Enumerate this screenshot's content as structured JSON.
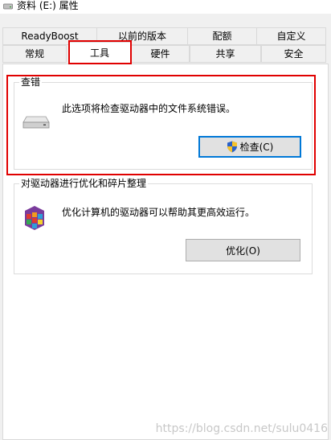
{
  "window": {
    "title": "资料 (E:) 属性"
  },
  "tabs": {
    "row1": [
      {
        "label": "ReadyBoost"
      },
      {
        "label": "以前的版本"
      },
      {
        "label": "配额"
      },
      {
        "label": "自定义"
      }
    ],
    "row2": [
      {
        "label": "常规"
      },
      {
        "label": "工具"
      },
      {
        "label": "硬件"
      },
      {
        "label": "共享"
      },
      {
        "label": "安全"
      }
    ],
    "active": "工具"
  },
  "error_check": {
    "title": "查错",
    "description": "此选项将检查驱动器中的文件系统错误。",
    "button": "检查(C)",
    "icons": {
      "drive": "drive-icon",
      "shield": "uac-shield-icon"
    }
  },
  "optimize": {
    "title": "对驱动器进行优化和碎片整理",
    "description": "优化计算机的驱动器可以帮助其更高效运行。",
    "button": "优化(O)",
    "icons": {
      "defrag": "defrag-icon"
    }
  },
  "watermark": "https://blog.csdn.net/sulu0416",
  "colors": {
    "annotation": "#e00000",
    "focus": "#0078d7"
  }
}
